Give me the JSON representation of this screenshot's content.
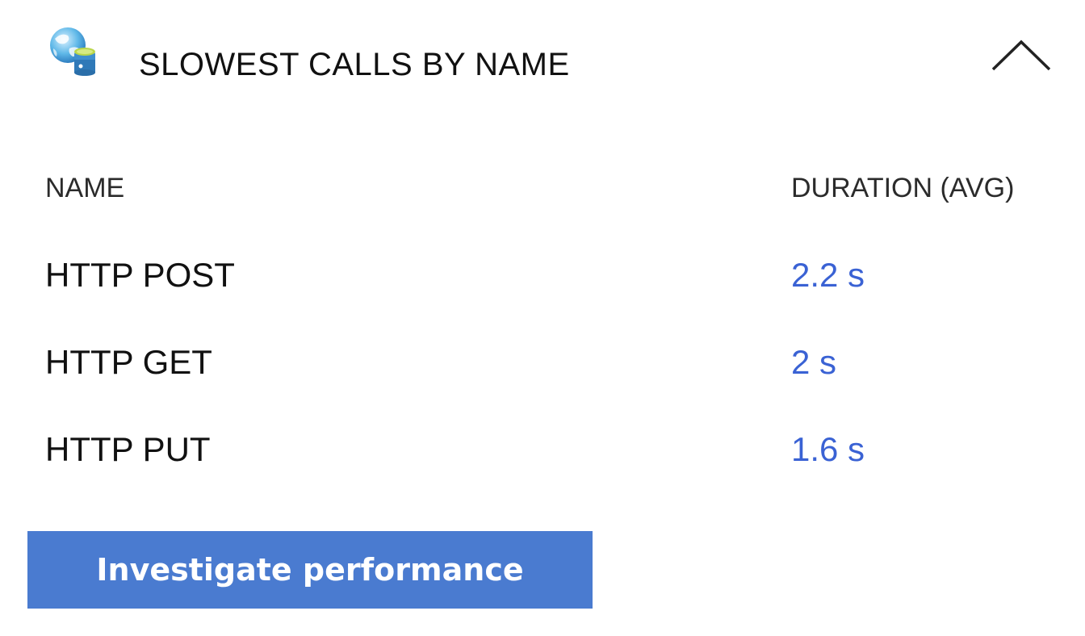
{
  "panel": {
    "title": "SLOWEST CALLS BY NAME",
    "icon": "globe-database-icon",
    "collapse_icon": "chevron-up-icon"
  },
  "table": {
    "columns": [
      "NAME",
      "DURATION (AVG)"
    ],
    "rows": [
      {
        "name": "HTTP POST",
        "duration": "2.2 s"
      },
      {
        "name": "HTTP GET",
        "duration": "2 s"
      },
      {
        "name": "HTTP PUT",
        "duration": "1.6 s"
      }
    ]
  },
  "actions": {
    "investigate_label": "Investigate performance"
  },
  "colors": {
    "link": "#3a62d4",
    "button_bg": "#4a7bd0",
    "button_text": "#ffffff"
  }
}
